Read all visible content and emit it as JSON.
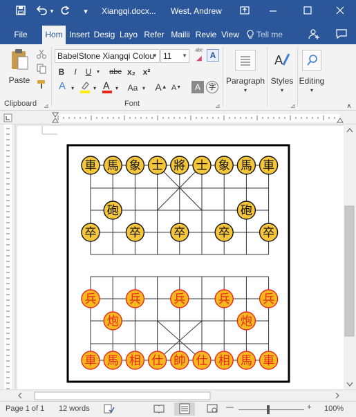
{
  "window": {
    "doc_title": "Xiangqi.docx...",
    "user_name": "West, Andrew",
    "qat_dropdown": "▾"
  },
  "tabs": [
    {
      "label": "File",
      "active": false
    },
    {
      "label": "Hom",
      "active": true
    },
    {
      "label": "Insert",
      "active": false
    },
    {
      "label": "Desig",
      "active": false
    },
    {
      "label": "Layo",
      "active": false
    },
    {
      "label": "Refer",
      "active": false
    },
    {
      "label": "Mailii",
      "active": false
    },
    {
      "label": "Revie",
      "active": false
    },
    {
      "label": "View",
      "active": false
    },
    {
      "label": "Tell me",
      "active": false
    }
  ],
  "ribbon": {
    "clipboard": {
      "paste_label": "Paste",
      "group_label": "Clipboard"
    },
    "font": {
      "font_name": "BabelStone Xiangqi Colou",
      "font_size": "11",
      "bold": "B",
      "italic": "I",
      "underline": "U",
      "strike": "abc",
      "subscript": "x₂",
      "superscript": "x²",
      "change_case": "Aa",
      "group_label": "Font"
    },
    "paragraph": {
      "label": "Paragraph"
    },
    "styles": {
      "label": "Styles"
    },
    "editing": {
      "label": "Editing"
    }
  },
  "board": {
    "colors": {
      "black_fill": "#f5c53a",
      "black_text": "#111111",
      "red_fill": "#f7b71f",
      "red_text": "#e8261c",
      "red_stroke": "#e8261c",
      "black_stroke": "#111111"
    },
    "black_pieces": [
      {
        "glyph": "車",
        "file": 0,
        "rank": 0
      },
      {
        "glyph": "馬",
        "file": 1,
        "rank": 0
      },
      {
        "glyph": "象",
        "file": 2,
        "rank": 0
      },
      {
        "glyph": "士",
        "file": 3,
        "rank": 0
      },
      {
        "glyph": "將",
        "file": 4,
        "rank": 0
      },
      {
        "glyph": "士",
        "file": 5,
        "rank": 0
      },
      {
        "glyph": "象",
        "file": 6,
        "rank": 0
      },
      {
        "glyph": "馬",
        "file": 7,
        "rank": 0
      },
      {
        "glyph": "車",
        "file": 8,
        "rank": 0
      },
      {
        "glyph": "砲",
        "file": 1,
        "rank": 2
      },
      {
        "glyph": "砲",
        "file": 7,
        "rank": 2
      },
      {
        "glyph": "卒",
        "file": 0,
        "rank": 3
      },
      {
        "glyph": "卒",
        "file": 2,
        "rank": 3
      },
      {
        "glyph": "卒",
        "file": 4,
        "rank": 3
      },
      {
        "glyph": "卒",
        "file": 6,
        "rank": 3
      },
      {
        "glyph": "卒",
        "file": 8,
        "rank": 3
      }
    ],
    "red_pieces": [
      {
        "glyph": "兵",
        "file": 0,
        "rank": 6
      },
      {
        "glyph": "兵",
        "file": 2,
        "rank": 6
      },
      {
        "glyph": "兵",
        "file": 4,
        "rank": 6
      },
      {
        "glyph": "兵",
        "file": 6,
        "rank": 6
      },
      {
        "glyph": "兵",
        "file": 8,
        "rank": 6
      },
      {
        "glyph": "炮",
        "file": 1,
        "rank": 7
      },
      {
        "glyph": "炮",
        "file": 7,
        "rank": 7
      },
      {
        "glyph": "車",
        "file": 0,
        "rank": 9
      },
      {
        "glyph": "馬",
        "file": 1,
        "rank": 9
      },
      {
        "glyph": "相",
        "file": 2,
        "rank": 9
      },
      {
        "glyph": "仕",
        "file": 3,
        "rank": 9
      },
      {
        "glyph": "帥",
        "file": 4,
        "rank": 9
      },
      {
        "glyph": "仕",
        "file": 5,
        "rank": 9
      },
      {
        "glyph": "相",
        "file": 6,
        "rank": 9
      },
      {
        "glyph": "馬",
        "file": 7,
        "rank": 9
      },
      {
        "glyph": "車",
        "file": 8,
        "rank": 9
      }
    ]
  },
  "status": {
    "page": "Page 1 of 1",
    "words": "12 words",
    "zoom": "100%",
    "zoom_minus": "—",
    "zoom_plus": "+"
  },
  "icons": {
    "save": "save-icon",
    "undo": "undo-icon",
    "redo": "redo-icon",
    "minimize": "minimize-icon",
    "restore": "restore-icon",
    "close": "close-icon",
    "lightbulb": "lightbulb-icon",
    "share": "share-icon",
    "comment": "comment-icon"
  }
}
